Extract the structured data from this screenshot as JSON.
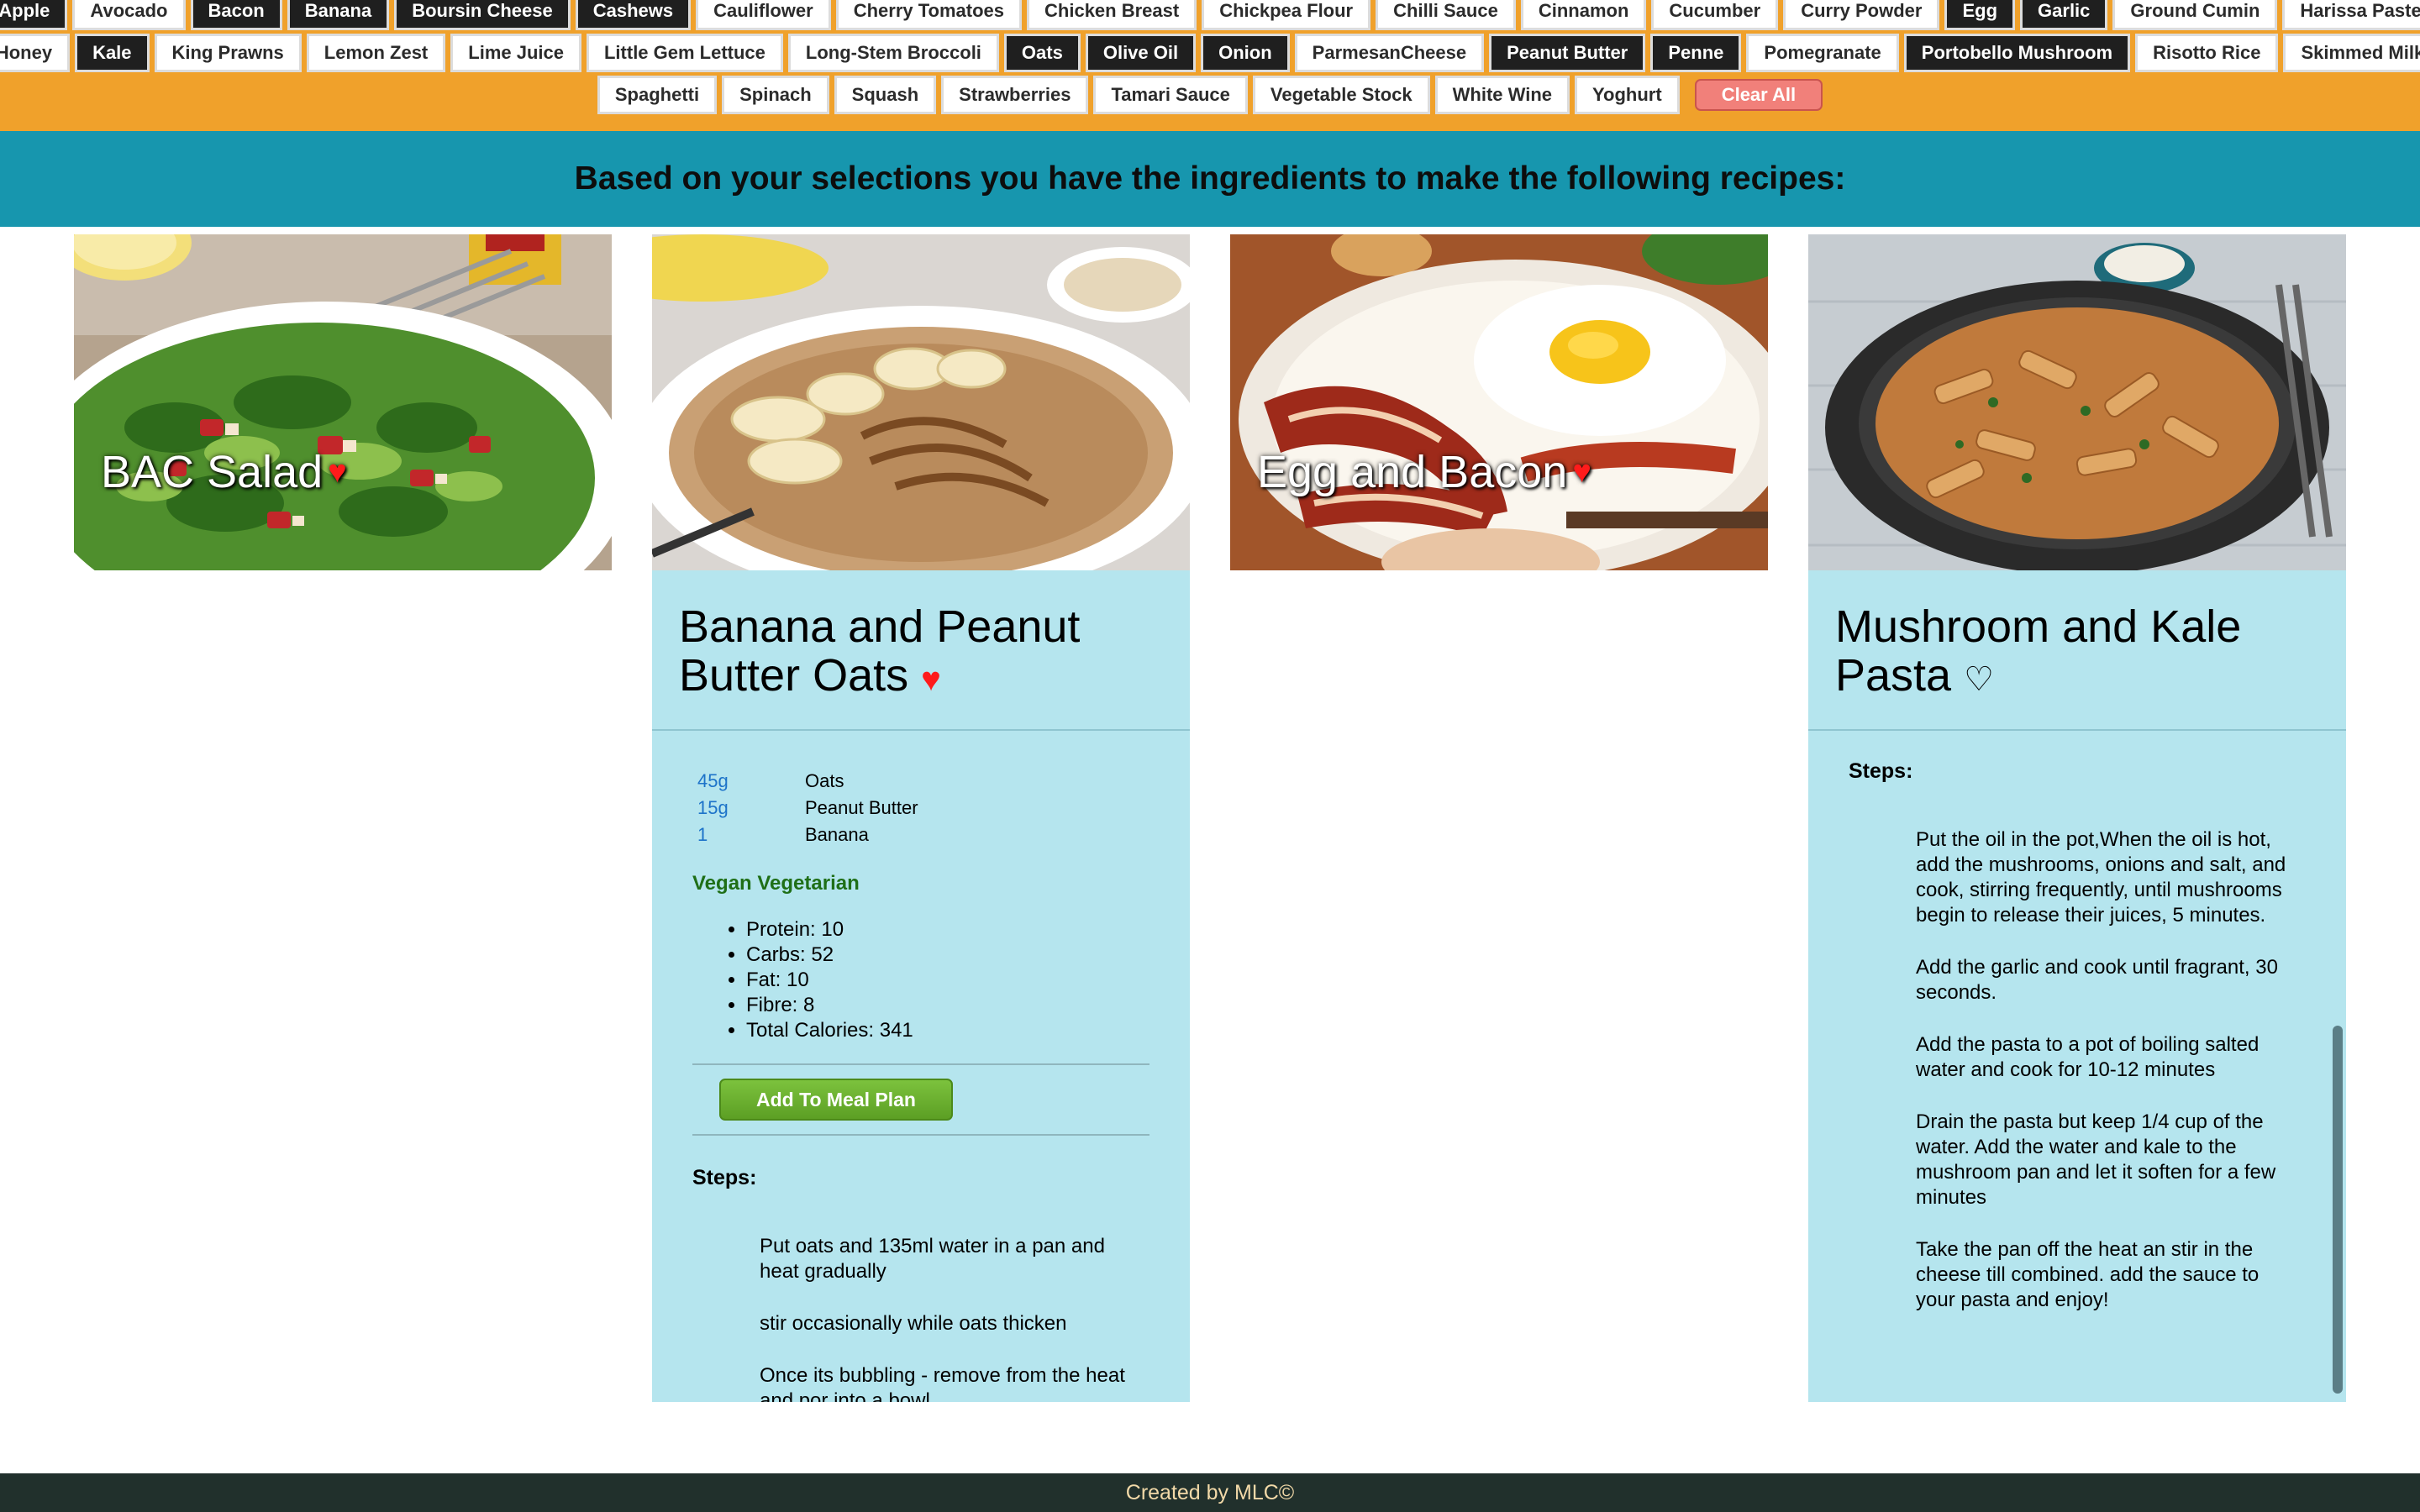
{
  "ingredients": {
    "row1": [
      {
        "label": "Apple",
        "selected": true
      },
      {
        "label": "Avocado",
        "selected": false
      },
      {
        "label": "Bacon",
        "selected": true
      },
      {
        "label": "Banana",
        "selected": true
      },
      {
        "label": "Boursin Cheese",
        "selected": true
      },
      {
        "label": "Cashews",
        "selected": true
      },
      {
        "label": "Cauliflower",
        "selected": false
      },
      {
        "label": "Cherry Tomatoes",
        "selected": false
      },
      {
        "label": "Chicken Breast",
        "selected": false
      },
      {
        "label": "Chickpea Flour",
        "selected": false
      },
      {
        "label": "Chilli Sauce",
        "selected": false
      },
      {
        "label": "Cinnamon",
        "selected": false
      },
      {
        "label": "Cucumber",
        "selected": false
      },
      {
        "label": "Curry Powder",
        "selected": false
      },
      {
        "label": "Egg",
        "selected": true
      },
      {
        "label": "Garlic",
        "selected": true
      },
      {
        "label": "Ground Cumin",
        "selected": false
      },
      {
        "label": "Harissa Paste",
        "selected": false
      }
    ],
    "row2": [
      {
        "label": "Honey",
        "selected": false
      },
      {
        "label": "Kale",
        "selected": true
      },
      {
        "label": "King Prawns",
        "selected": false
      },
      {
        "label": "Lemon Zest",
        "selected": false
      },
      {
        "label": "Lime Juice",
        "selected": false
      },
      {
        "label": "Little Gem Lettuce",
        "selected": false
      },
      {
        "label": "Long-Stem Broccoli",
        "selected": false
      },
      {
        "label": "Oats",
        "selected": true
      },
      {
        "label": "Olive Oil",
        "selected": true
      },
      {
        "label": "Onion",
        "selected": true
      },
      {
        "label": "ParmesanCheese",
        "selected": false
      },
      {
        "label": "Peanut Butter",
        "selected": true
      },
      {
        "label": "Penne",
        "selected": true
      },
      {
        "label": "Pomegranate",
        "selected": false
      },
      {
        "label": "Portobello Mushroom",
        "selected": true
      },
      {
        "label": "Risotto Rice",
        "selected": false
      },
      {
        "label": "Skimmed Milk",
        "selected": false
      }
    ],
    "row3": [
      {
        "label": "Spaghetti",
        "selected": false
      },
      {
        "label": "Spinach",
        "selected": false
      },
      {
        "label": "Squash",
        "selected": false
      },
      {
        "label": "Strawberries",
        "selected": false
      },
      {
        "label": "Tamari Sauce",
        "selected": false
      },
      {
        "label": "Vegetable Stock",
        "selected": false
      },
      {
        "label": "White Wine",
        "selected": false
      },
      {
        "label": "Yoghurt",
        "selected": false
      }
    ],
    "clear_label": "Clear All"
  },
  "banner": {
    "text": "Based on your selections you have the ingredients to make the following recipes:"
  },
  "colors": {
    "bar": "#f0a12b",
    "banner": "#1796ae",
    "card": "#b5e5ee",
    "heart": "#ff1b1b",
    "qty": "#1d73c9",
    "diet": "#1f6f17",
    "footer": "#21302c"
  },
  "recipes": [
    {
      "photo_title": "BAC Salad",
      "favorite": true,
      "icon": "heart-filled-icon"
    },
    {
      "title": "Banana and Peanut Butter Oats",
      "favorite": true,
      "icon": "heart-filled-icon",
      "ingredients": [
        {
          "qty": "45g",
          "name": "Oats"
        },
        {
          "qty": "15g",
          "name": "Peanut Butter"
        },
        {
          "qty": "1",
          "name": "Banana"
        }
      ],
      "diet": "Vegan Vegetarian",
      "macros": [
        "Protein: 10",
        "Carbs: 52",
        "Fat: 10",
        "Fibre: 8",
        "Total Calories: 341"
      ],
      "meal_plan_label": "Add To Meal Plan",
      "steps_label": "Steps:",
      "steps": [
        "Put oats and 135ml water in a pan and heat gradually",
        "stir occasionally while oats thicken",
        "Once its bubbling - remove from the heat and por into a bowl"
      ]
    },
    {
      "photo_title": "Egg and Bacon",
      "favorite": true,
      "icon": "heart-filled-icon"
    },
    {
      "title": "Mushroom and Kale Pasta",
      "favorite": false,
      "icon": "heart-outline-icon",
      "steps_label": "Steps:",
      "steps": [
        "Put the oil in the pot,When the oil is hot, add the mushrooms, onions and salt, and cook, stirring frequently, until mushrooms begin to release their juices, 5 minutes.",
        "Add the garlic and cook until fragrant, 30 seconds.",
        "Add the pasta to a pot of boiling salted water and cook for 10-12 minutes",
        "Drain the pasta but keep 1/4 cup of the water. Add the water and kale to the mushroom pan and let it soften for a few minutes",
        "Take the pan off the heat an stir in the cheese till combined. add the sauce to your pasta and enjoy!"
      ]
    }
  ],
  "footer": {
    "text": "Created by MLC©"
  }
}
